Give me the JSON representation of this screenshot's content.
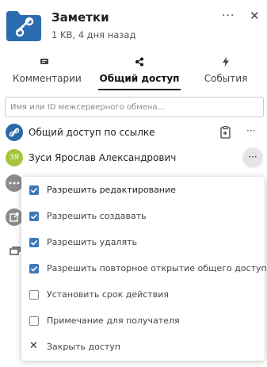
{
  "header": {
    "title": "Заметки",
    "subtitle": "1 KB, 4 дня назад",
    "more_label": "···",
    "close_label": "✕"
  },
  "tabs": [
    {
      "label": "Комментарии",
      "icon": "chat-icon"
    },
    {
      "label": "Общий доступ",
      "icon": "share-icon",
      "active": true
    },
    {
      "label": "События",
      "icon": "bolt-icon"
    }
  ],
  "search": {
    "placeholder": "Имя или ID межсерверного обмена..."
  },
  "shares": {
    "link_label": "Общий доступ по ссылке",
    "user_initials": "ЗЯ",
    "user_name": "Зуси Ярослав Александрович",
    "more_label": "···"
  },
  "menu": {
    "items": [
      {
        "label": "Разрешить редактирование",
        "checked": true
      },
      {
        "label": "Разрешить создавать",
        "checked": true
      },
      {
        "label": "Разрешить удалять",
        "checked": true
      },
      {
        "label": "Разрешить повторное открытие общего доступа",
        "checked": true
      },
      {
        "label": "Установить срок действия",
        "checked": false
      },
      {
        "label": "Примечание для получателя",
        "checked": false
      }
    ],
    "close_label": "Закрыть доступ"
  },
  "colors": {
    "accent": "#3d78ba",
    "link_avatar": "#2a68a8",
    "user_avatar": "#a5c43a"
  }
}
